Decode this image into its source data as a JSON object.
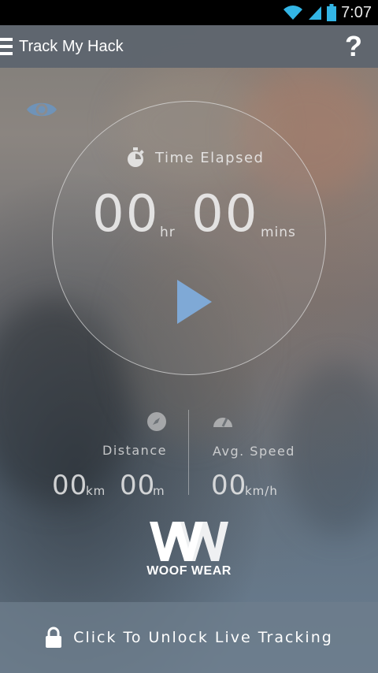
{
  "status_bar": {
    "time": "7:07",
    "icons": [
      "wifi-icon",
      "signal-icon",
      "battery-icon"
    ]
  },
  "action_bar": {
    "menu_icon": "hamburger-menu-icon",
    "title": "Track My Hack",
    "help_label": "?"
  },
  "visibility_icon": "eye-icon",
  "timer": {
    "icon": "stopwatch-icon",
    "label": "Time Elapsed",
    "hours": "00",
    "hours_unit": "hr",
    "minutes": "00",
    "minutes_unit": "mins",
    "play_icon": "play-icon"
  },
  "distance": {
    "icon": "compass-icon",
    "label": "Distance",
    "km_value": "00",
    "km_unit": "km",
    "m_value": "00",
    "m_unit": "m"
  },
  "speed": {
    "icon": "speedometer-icon",
    "label": "Avg. Speed",
    "value": "00",
    "unit": "km/h"
  },
  "brand": {
    "logo": "woof-wear-logo",
    "name": "WOOF WEAR"
  },
  "unlock": {
    "icon": "lock-icon",
    "label": "Click To Unlock Live Tracking"
  },
  "colors": {
    "accent_play": "#7fa9d6",
    "status_bar_bg": "#000000",
    "action_bar_bg": "#5c646e"
  }
}
